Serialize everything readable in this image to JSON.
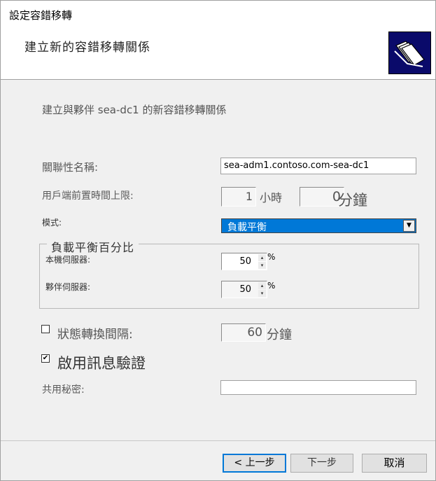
{
  "window": {
    "title": "設定容錯移轉",
    "subtitle": "建立新的容錯移轉關係",
    "icon": "folders-icon"
  },
  "description": "建立與夥伴 sea-dc1 的新容錯移轉關係",
  "relationship_name": {
    "label": "關聯性名稱:",
    "value": "sea-adm1.contoso.com-sea-dc1"
  },
  "mclt": {
    "label": "用戶端前置時間上限:",
    "hours_value": "1",
    "hours_unit": "小時",
    "minutes_value": "0",
    "minutes_unit": "分鐘"
  },
  "mode": {
    "label": "模式:",
    "selected": "負載平衡"
  },
  "load_balance": {
    "group_title": "負載平衡百分比",
    "local_server_label": "本機伺服器:",
    "local_server_value": "50",
    "partner_server_label": "夥伴伺服器:",
    "partner_server_value": "50",
    "percent": "%"
  },
  "state_switchover": {
    "checked": false,
    "label": "狀態轉換間隔:",
    "value": "60",
    "unit": "分鐘"
  },
  "message_auth": {
    "checked": true,
    "label": "啟用訊息驗證",
    "check_mark": "✔"
  },
  "shared_secret": {
    "label": "共用秘密:",
    "value": ""
  },
  "buttons": {
    "back": "< 上一步",
    "next": "下一步",
    "cancel": "取消"
  },
  "colors": {
    "selection": "#0078d7",
    "icon_bg": "#0a0a6a"
  }
}
